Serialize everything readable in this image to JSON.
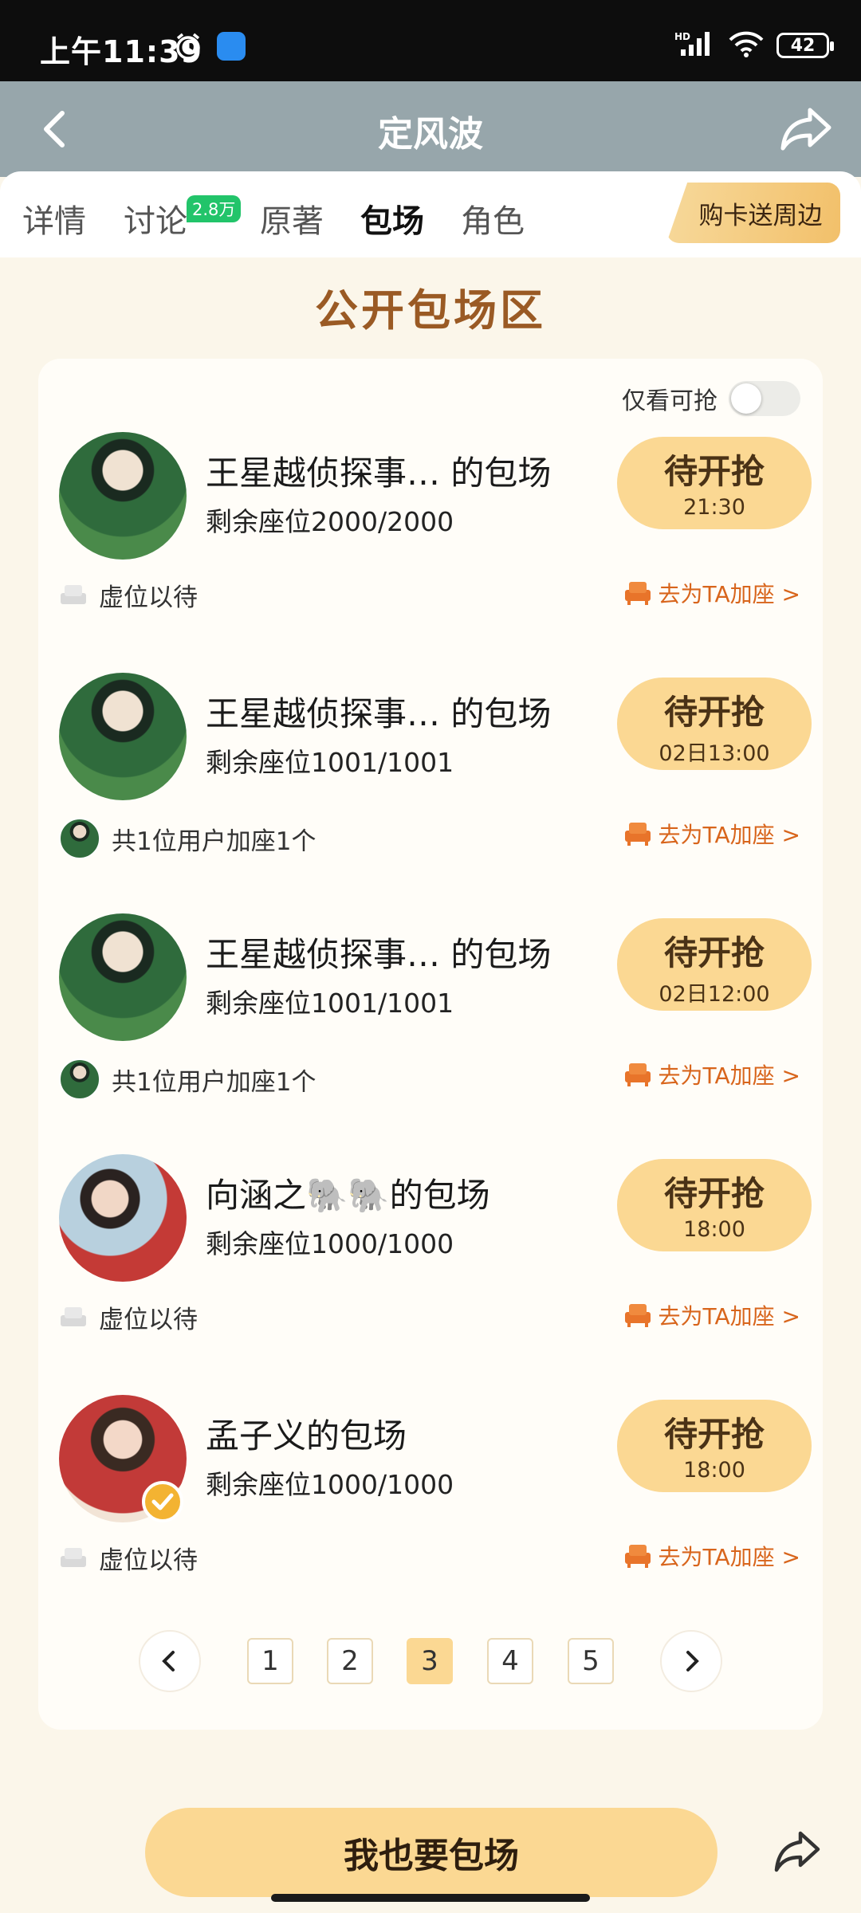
{
  "status": {
    "time": "上午11:39",
    "battery": "42"
  },
  "header": {
    "title": "定风波"
  },
  "tabs": [
    {
      "label": "详情"
    },
    {
      "label": "讨论",
      "badge": "2.8万"
    },
    {
      "label": "原著"
    },
    {
      "label": "包场"
    },
    {
      "label": "角色"
    }
  ],
  "promo_label": "购卡送周边",
  "section_title": "公开包场区",
  "filter_label": "仅看可抢",
  "items": [
    {
      "name": "王星越侦探事…  的包场",
      "seats": "剩余座位2000/2000",
      "button": "待开抢",
      "time": "21:30",
      "footer_left": "虚位以待",
      "footer_right": "去为TA加座 >"
    },
    {
      "name": "王星越侦探事…  的包场",
      "seats": "剩余座位1001/1001",
      "button": "待开抢",
      "time": "02日13:00",
      "footer_left": "共1位用户加座1个",
      "footer_right": "去为TA加座 >"
    },
    {
      "name": "王星越侦探事…  的包场",
      "seats": "剩余座位1001/1001",
      "button": "待开抢",
      "time": "02日12:00",
      "footer_left": "共1位用户加座1个",
      "footer_right": "去为TA加座 >"
    },
    {
      "name": "向涵之🐘🐘的包场",
      "seats": "剩余座位1000/1000",
      "button": "待开抢",
      "time": "18:00",
      "footer_left": "虚位以待",
      "footer_right": "去为TA加座 >"
    },
    {
      "name": "孟子义的包场",
      "seats": "剩余座位1000/1000",
      "button": "待开抢",
      "time": "18:00",
      "footer_left": "虚位以待",
      "footer_right": "去为TA加座 >"
    }
  ],
  "pagination": {
    "pages": [
      "1",
      "2",
      "3",
      "4",
      "5"
    ],
    "current": "3"
  },
  "cta_label": "我也要包场",
  "colors": {
    "accent": "#fbd893",
    "brand_brown": "#9a5a24",
    "link_orange": "#d8651c",
    "header_bg": "#97a6ab"
  }
}
